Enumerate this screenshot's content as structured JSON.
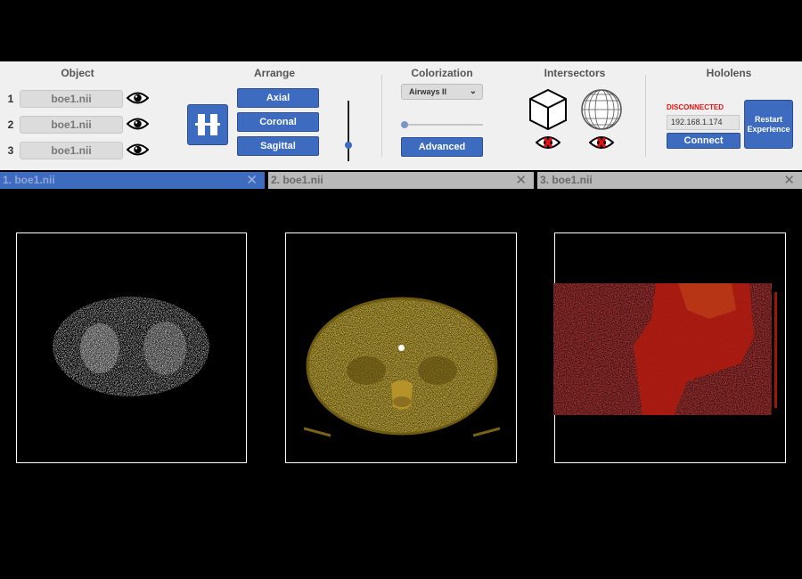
{
  "toolbar": {
    "object": {
      "title": "Object",
      "rows": [
        {
          "num": "1",
          "name": "boe1.nii",
          "visible_icon": "eye-icon"
        },
        {
          "num": "2",
          "name": "boe1.nii",
          "visible_icon": "eye-icon"
        },
        {
          "num": "3",
          "name": "boe1.nii",
          "visible_icon": "eye-icon"
        }
      ]
    },
    "arrange": {
      "title": "Arrange",
      "layout_icon": "arrange-layout-icon",
      "buttons": [
        "Axial",
        "Coronal",
        "Sagittal"
      ],
      "slider_level": 0.26
    },
    "colorization": {
      "title": "Colorization",
      "selected_preset": "Airways II",
      "slider_level": 0.05,
      "advanced_label": "Advanced"
    },
    "intersectors": {
      "title": "Intersectors",
      "items": [
        {
          "icon": "cube-icon",
          "visibility_icon": "eye-hidden-icon"
        },
        {
          "icon": "sphere-icon",
          "visibility_icon": "eye-hidden-icon"
        }
      ]
    },
    "hololens": {
      "title": "Hololens",
      "status": "DISCONNECTED",
      "ip": "192.168.1.174",
      "connect_label": "Connect",
      "restart_label_line1": "Restart",
      "restart_label_line2": "Experience"
    }
  },
  "viewports": [
    {
      "title": "1. boe1.nii",
      "active": true,
      "modality_view": "axial lung, white"
    },
    {
      "title": "2. boe1.nii",
      "active": false,
      "modality_view": "axial abdomen, yellow"
    },
    {
      "title": "3. boe1.nii",
      "active": false,
      "modality_view": "sagittal, red"
    }
  ],
  "colors": {
    "accent": "#3d6bbf",
    "status_error": "#e81010",
    "toolbar_bg": "#f0f0f0",
    "header_active": "#3d6bbf",
    "header_inactive": "#b9b9b9"
  }
}
